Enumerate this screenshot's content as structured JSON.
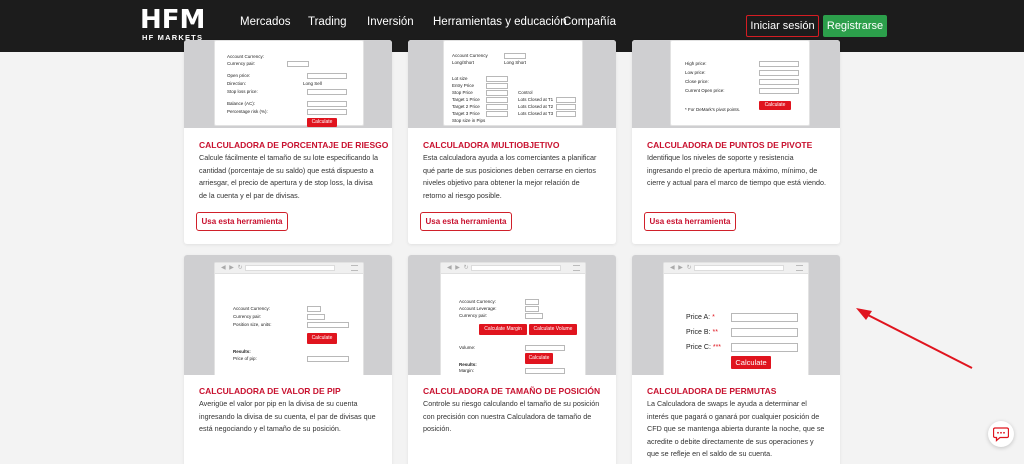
{
  "brand": {
    "name": "HFM",
    "sub": "HF MARKETS"
  },
  "nav": [
    {
      "label": "Mercados"
    },
    {
      "label": "Trading"
    },
    {
      "label": "Inversión"
    },
    {
      "label": "Herramientas y educación"
    },
    {
      "label": "Compañía"
    }
  ],
  "header": {
    "login": "Iniciar sesión",
    "register": "Registrarse"
  },
  "colors": {
    "accent": "#c8102e",
    "green": "#2c9f4b",
    "topbar": "#1c1c1c"
  },
  "cards": [
    {
      "title": "CALCULADORA DE PORCENTAJE DE RIESGO",
      "desc": "Calcule fácilmente el tamaño de su lote especificando la cantidad (porcentaje de su saldo) que está dispuesto a arriesgar, el precio de apertura y de stop loss, la divisa de la cuenta y el par de divisas.",
      "button": "Usa esta herramienta",
      "preview": {
        "labels": [
          "Account Currency:",
          "Currency pair:",
          "Open price:",
          "Direction:",
          "Stop loss price:",
          "Balance (AC):",
          "Percentage risk (%):"
        ],
        "direction": "Long  Sell",
        "calc": "Calculate"
      }
    },
    {
      "title": "CALCULADORA MULTIOBJETIVO",
      "desc": "Esta calculadora ayuda a los comerciantes a planificar qué parte de sus posiciones deben cerrarse en ciertos niveles objetivo para obtener la mejor relación de retorno al riesgo posible.",
      "button": "Usa esta herramienta",
      "preview": {
        "labels": [
          "Account Currency",
          "Long/Short",
          "Lot size",
          "Entry Price",
          "Stop Price",
          "Target 1 Price",
          "Target 2 Price",
          "Target 3 Price",
          "Stop size in Pips"
        ],
        "right": [
          "Control",
          "Lots Closed at T1",
          "Lots Closed at T2",
          "Lots Closed at T3"
        ],
        "longshort": "Long  Short"
      }
    },
    {
      "title": "CALCULADORA DE PUNTOS DE PIVOTE",
      "desc": "Identifique los niveles de soporte y resistencia ingresando el precio de apertura máximo, mínimo, de cierre y actual para el marco de tiempo que está viendo.",
      "button": "Usa esta herramienta",
      "preview": {
        "labels": [
          "High price:",
          "Low price:",
          "Close price:",
          "Current Open price:"
        ],
        "note": "* For DeMark's pivot points.",
        "calc": "Calculate"
      }
    },
    {
      "title": "CALCULADORA DE VALOR DE PIP",
      "desc": "Averigüe el valor por pip en la divisa de su cuenta ingresando la divisa de su cuenta, el par de divisas que está negociando y el tamaño de su posición.",
      "preview": {
        "labels": [
          "Account Currency:",
          "Currency pair:",
          "Position size, units:"
        ],
        "result": "Results:",
        "pip": "Price of pip:",
        "calc": "Calculate"
      }
    },
    {
      "title": "CALCULADORA DE TAMAÑO DE POSICIÓN",
      "desc": "Controle su riesgo calculando el tamaño de su posición con precisión con nuestra Calculadora de tamaño de posición.",
      "preview": {
        "labels": [
          "Account Currency:",
          "Account Leverage:",
          "Currency pair:"
        ],
        "margin": "Calculate Margin",
        "volume_btn": "Calculate Volume",
        "volume": "Volume:",
        "result": "Results:",
        "margin_lbl": "Margin:",
        "calc": "Calculate"
      }
    },
    {
      "title": "CALCULADORA DE PERMUTAS",
      "desc": "La Calculadora de swaps le ayuda a determinar el interés que pagará o ganará por cualquier posición de CFD que se mantenga abierta durante la noche, que se acredite o debite directamente de sus operaciones y que se refleje en el saldo de su cuenta.",
      "preview": {
        "a": "Price A:",
        "a_mark": "*",
        "b": "Price B:",
        "b_mark": "**",
        "c": "Price C:",
        "c_mark": "***",
        "calc": "Calculate"
      }
    }
  ]
}
